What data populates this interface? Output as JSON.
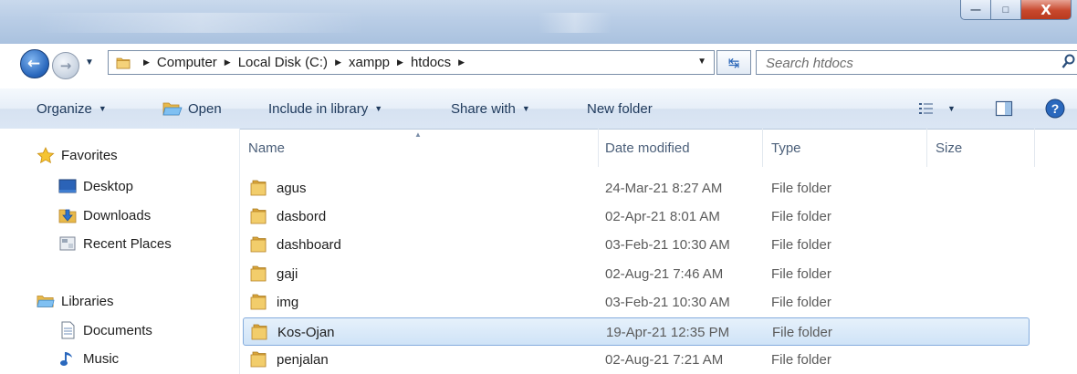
{
  "window": {
    "minimize_glyph": "—",
    "maximize_glyph": "□",
    "close_glyph": "X"
  },
  "address": {
    "crumbs": [
      "Computer",
      "Local Disk (C:)",
      "xampp",
      "htdocs"
    ]
  },
  "search": {
    "placeholder": "Search htdocs"
  },
  "toolbar": {
    "organize": "Organize",
    "open": "Open",
    "include_in_library": "Include in library",
    "share_with": "Share with",
    "new_folder": "New folder"
  },
  "nav": {
    "favorites": "Favorites",
    "desktop": "Desktop",
    "downloads": "Downloads",
    "recent_places": "Recent Places",
    "libraries": "Libraries",
    "documents": "Documents",
    "music": "Music"
  },
  "columns": {
    "name": "Name",
    "date_modified": "Date modified",
    "type": "Type",
    "size": "Size"
  },
  "files": [
    {
      "name": "agus",
      "date": "24-Mar-21 8:27 AM",
      "type": "File folder"
    },
    {
      "name": "dasbord",
      "date": "02-Apr-21 8:01 AM",
      "type": "File folder"
    },
    {
      "name": "dashboard",
      "date": "03-Feb-21 10:30 AM",
      "type": "File folder"
    },
    {
      "name": "gaji",
      "date": "02-Aug-21 7:46 AM",
      "type": "File folder"
    },
    {
      "name": "img",
      "date": "03-Feb-21 10:30 AM",
      "type": "File folder"
    },
    {
      "name": "Kos-Ojan",
      "date": "19-Apr-21 12:35 PM",
      "type": "File folder",
      "selected": true
    },
    {
      "name": "penjalan",
      "date": "02-Aug-21 7:21 AM",
      "type": "File folder"
    }
  ],
  "colors": {
    "selection": "#cfe3f7",
    "folder": "#e8b94a",
    "accent": "#2a68bd"
  },
  "icons": [
    "back-icon",
    "forward-icon",
    "folder-icon",
    "refresh-icon",
    "search-icon",
    "open-folder-icon",
    "views-icon",
    "preview-pane-icon",
    "help-icon",
    "star-icon",
    "desktop-icon",
    "downloads-icon",
    "recent-places-icon",
    "libraries-icon",
    "documents-icon",
    "music-icon"
  ]
}
